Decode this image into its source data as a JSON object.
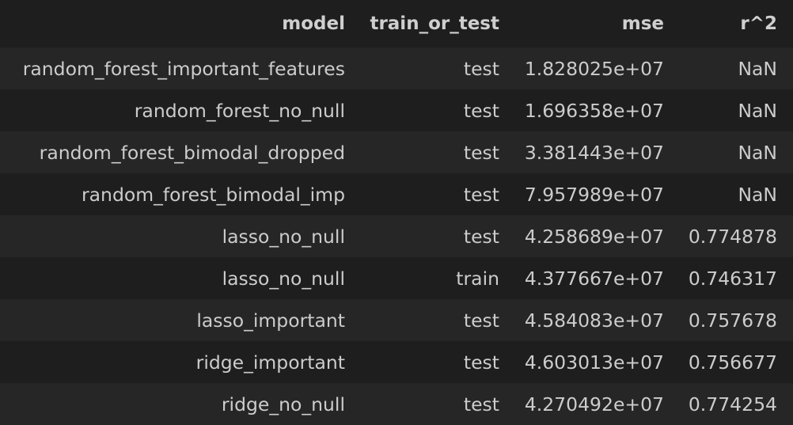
{
  "table": {
    "headers": [
      "model",
      "train_or_test",
      "mse",
      "r^2"
    ],
    "rows": [
      [
        "random_forest_important_features",
        "test",
        "1.828025e+07",
        "NaN"
      ],
      [
        "random_forest_no_null",
        "test",
        "1.696358e+07",
        "NaN"
      ],
      [
        "random_forest_bimodal_dropped",
        "test",
        "3.381443e+07",
        "NaN"
      ],
      [
        "random_forest_bimodal_imp",
        "test",
        "7.957989e+07",
        "NaN"
      ],
      [
        "lasso_no_null",
        "test",
        "4.258689e+07",
        "0.774878"
      ],
      [
        "lasso_no_null",
        "train",
        "4.377667e+07",
        "0.746317"
      ],
      [
        "lasso_important",
        "test",
        "4.584083e+07",
        "0.757678"
      ],
      [
        "ridge_important",
        "test",
        "4.603013e+07",
        "0.756677"
      ],
      [
        "ridge_no_null",
        "test",
        "4.270492e+07",
        "0.774254"
      ]
    ]
  }
}
